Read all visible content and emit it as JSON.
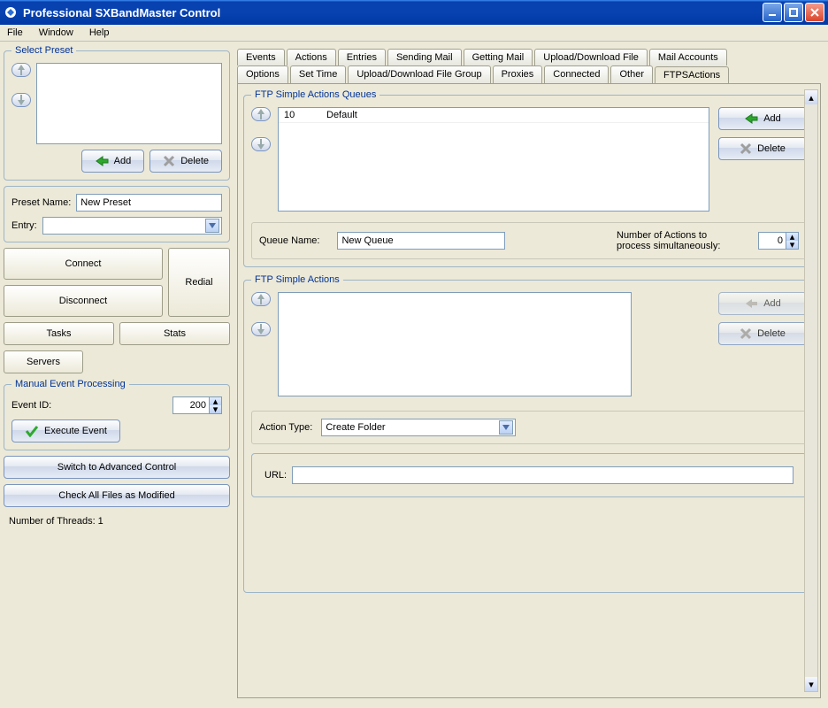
{
  "window": {
    "title": "Professional SXBandMaster Control"
  },
  "menubar": [
    "File",
    "Window",
    "Help"
  ],
  "selectPreset": {
    "legend": "Select Preset",
    "addLabel": "Add",
    "deleteLabel": "Delete",
    "presetNameLabel": "Preset Name:",
    "presetNameValue": "New Preset",
    "entryLabel": "Entry:"
  },
  "connectBtns": {
    "connect": "Connect",
    "disconnect": "Disconnect",
    "redial": "Redial",
    "tasks": "Tasks",
    "stats": "Stats",
    "servers": "Servers"
  },
  "manualEvent": {
    "legend": "Manual Event Processing",
    "eventIdLabel": "Event ID:",
    "eventIdValue": "200",
    "executeLabel": "Execute Event"
  },
  "switchBtn": "Switch to Advanced Control",
  "checkAllBtn": "Check All Files as Modified",
  "threadsLine": "Number of Threads: 1",
  "tabs": {
    "row1": [
      "Events",
      "Actions",
      "Entries",
      "Sending Mail",
      "Getting Mail",
      "Upload/Download File",
      "Mail Accounts"
    ],
    "row2": [
      "Options",
      "Set Time",
      "Upload/Download File Group",
      "Proxies",
      "Connected",
      "Other",
      "FTPSActions"
    ],
    "active": "FTPSActions"
  },
  "ftpQueues": {
    "legend": "FTP Simple Actions Queues",
    "rows": [
      {
        "id": "10",
        "name": "Default"
      }
    ],
    "addLabel": "Add",
    "deleteLabel": "Delete",
    "queueNameLabel": "Queue Name:",
    "queueNameValue": "New Queue",
    "numActionsLabel": "Number of Actions to process simultaneously:",
    "numActionsValue": "0"
  },
  "ftpActions": {
    "legend": "FTP Simple Actions",
    "addLabel": "Add",
    "deleteLabel": "Delete",
    "actionTypeLabel": "Action Type:",
    "actionTypeValue": "Create Folder",
    "urlLabel": "URL:",
    "urlValue": ""
  }
}
